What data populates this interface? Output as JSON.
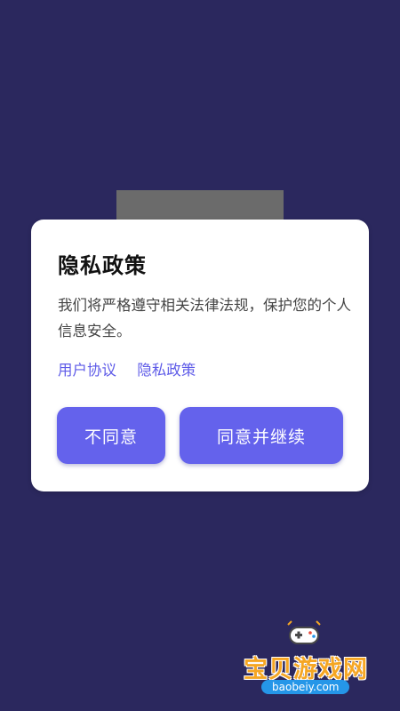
{
  "dialog": {
    "title": "隐私政策",
    "body": "我们将严格遵守相关法律法规，保护您的个人信息安全。",
    "links": [
      "用户协议",
      "隐私政策"
    ],
    "disagree_label": "不同意",
    "agree_label": "同意并继续"
  },
  "watermark": {
    "name": "宝贝游戏网",
    "site": "baobeiy.com",
    "logo_icon": "gamepad-icon"
  },
  "colors": {
    "background": "#2b285e",
    "accent": "#6462ec",
    "link": "#5f5ce8"
  }
}
